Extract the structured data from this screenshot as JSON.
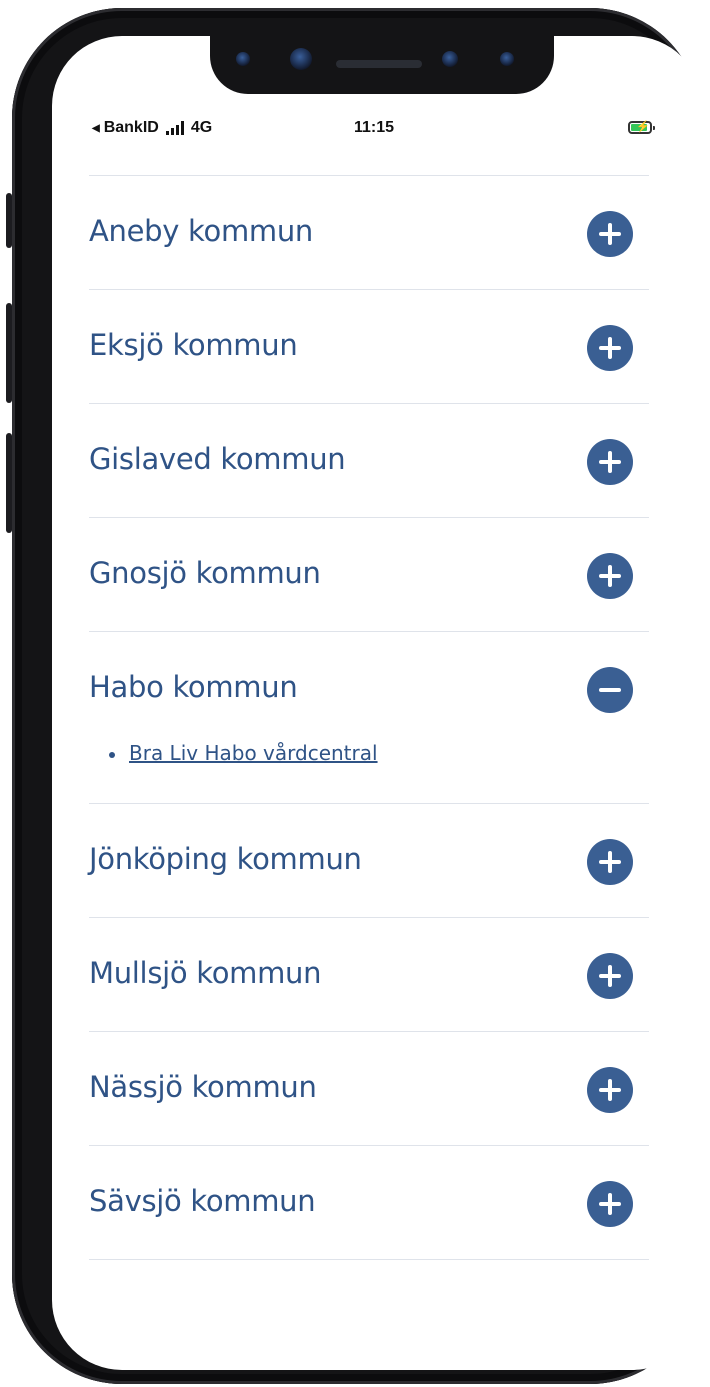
{
  "status_bar": {
    "back_app": "BankID",
    "network": "4G",
    "time": "11:15"
  },
  "colors": {
    "accent": "#3a5f93",
    "title": "#2f5386",
    "divider": "#dfe3ea"
  },
  "accordion": {
    "items": [
      {
        "title": "Aneby kommun",
        "icon": "plus-icon",
        "expanded": false
      },
      {
        "title": "Eksjö kommun",
        "icon": "plus-icon",
        "expanded": false
      },
      {
        "title": "Gislaved kommun",
        "icon": "plus-icon",
        "expanded": false
      },
      {
        "title": "Gnosjö kommun",
        "icon": "plus-icon",
        "expanded": false
      },
      {
        "title": "Habo kommun",
        "icon": "minus-icon",
        "expanded": true,
        "links": [
          "Bra Liv Habo vårdcentral"
        ]
      },
      {
        "title": "Jönköping kommun",
        "icon": "plus-icon",
        "expanded": false
      },
      {
        "title": "Mullsjö kommun",
        "icon": "plus-icon",
        "expanded": false
      },
      {
        "title": "Nässjö kommun",
        "icon": "plus-icon",
        "expanded": false
      },
      {
        "title": "Sävsjö kommun",
        "icon": "plus-icon",
        "expanded": false
      }
    ]
  }
}
